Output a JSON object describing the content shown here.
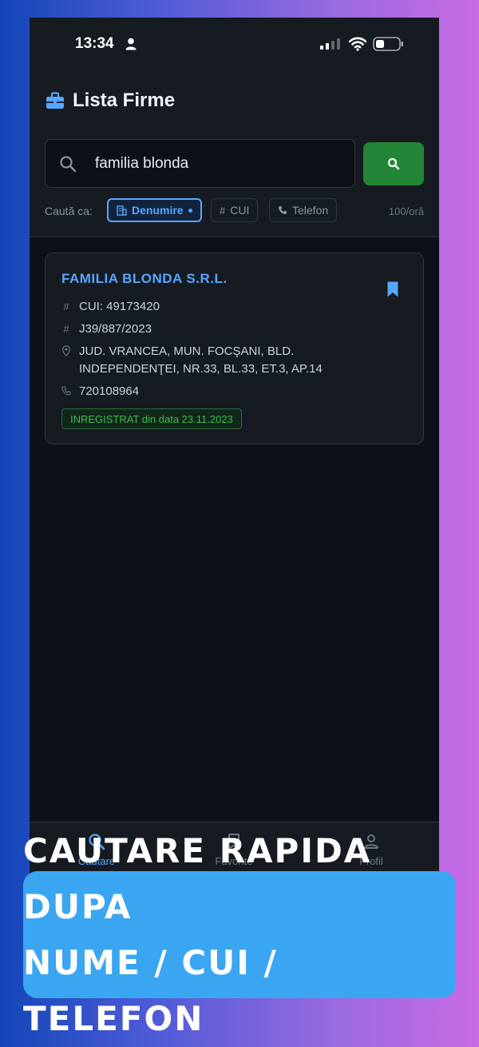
{
  "status_bar": {
    "time": "13:34"
  },
  "app": {
    "title": "Lista Firme"
  },
  "search": {
    "value": "familia blonda",
    "placeholder": ""
  },
  "filters": {
    "label": "Caută ca:",
    "options": [
      {
        "label": "Denumire",
        "active": true
      },
      {
        "label": "CUI",
        "active": false
      },
      {
        "label": "Telefon",
        "active": false
      }
    ],
    "rate_limit": "100/oră"
  },
  "results": [
    {
      "name": "FAMILIA BLONDA S.R.L.",
      "cui": "CUI: 49173420",
      "reg": "J39/887/2023",
      "address_line1": "JUD. VRANCEA, MUN. FOCŞANI, BLD.",
      "address_line2": "INDEPENDENŢEI, NR.33, BL.33, ET.3, AP.14",
      "phone": "720108964",
      "status": "INREGISTRAT din data 23.11.2023"
    }
  ],
  "nav": {
    "items": [
      {
        "label": "Căutare",
        "icon": "search-icon",
        "active": true
      },
      {
        "label": "Favorite",
        "icon": "bookmark-icon",
        "active": false
      },
      {
        "label": "Profil",
        "icon": "person-icon",
        "active": false
      }
    ]
  },
  "banner": {
    "line1": "CAUTARE RAPIDA DUPA",
    "line2": "NUME / CUI / TELEFON"
  },
  "colors": {
    "accent": "#58a6ff",
    "success": "#238636",
    "background": "#0d1117",
    "banner": "#3aa6f2"
  }
}
